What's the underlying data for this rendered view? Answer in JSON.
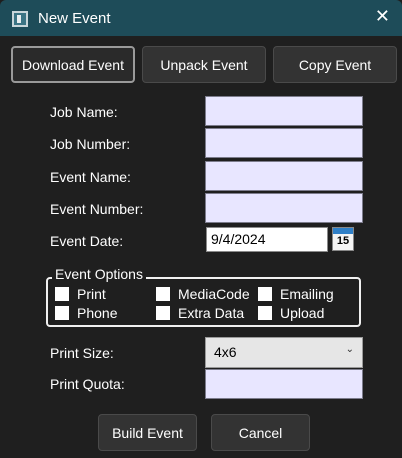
{
  "window": {
    "title": "New Event",
    "close_glyph": "✕"
  },
  "actions": {
    "download_label": "Download Event",
    "unpack_label": "Unpack Event",
    "copy_label": "Copy Event"
  },
  "form": {
    "job_name_label": "Job Name:",
    "job_number_label": "Job Number:",
    "event_name_label": "Event Name:",
    "event_number_label": "Event Number:",
    "event_date_label": "Event Date:",
    "event_date_value": "9/4/2024",
    "calendar_day": "15",
    "print_size_label": "Print Size:",
    "print_size_value": "4x6",
    "print_quota_label": "Print Quota:"
  },
  "options": {
    "title": "Event Options",
    "items": [
      {
        "label": "Print",
        "checked": false
      },
      {
        "label": "MediaCode",
        "checked": false
      },
      {
        "label": "Emailing",
        "checked": false
      },
      {
        "label": "Phone",
        "checked": false
      },
      {
        "label": "Extra Data",
        "checked": false
      },
      {
        "label": "Upload",
        "checked": false
      }
    ]
  },
  "footer": {
    "build_label": "Build Event",
    "cancel_label": "Cancel"
  },
  "icons": {
    "app": "app-window-icon",
    "calendar": "calendar-icon",
    "close": "close-icon",
    "dropdown": "chevron-down-icon"
  },
  "colors": {
    "titlebar": "#1e4c59",
    "background": "#1f1f1f",
    "input_fill": "#e8e6ff"
  }
}
